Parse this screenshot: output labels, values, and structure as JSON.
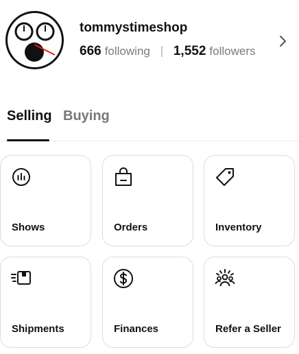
{
  "profile": {
    "username": "tommystimeshop",
    "following_count": "666",
    "following_label": "following",
    "followers_count": "1,552",
    "followers_label": "followers",
    "avatar_icon": "watch-face-avatar",
    "chevron_icon": "chevron-right-icon"
  },
  "tabs": [
    {
      "label": "Selling",
      "active": true
    },
    {
      "label": "Buying",
      "active": false
    }
  ],
  "grid": [
    {
      "label": "Shows",
      "icon": "chart-circle-icon"
    },
    {
      "label": "Orders",
      "icon": "shopping-bag-icon"
    },
    {
      "label": "Inventory",
      "icon": "tag-icon"
    },
    {
      "label": "Shipments",
      "icon": "shipping-box-icon"
    },
    {
      "label": "Finances",
      "icon": "dollar-circle-icon"
    },
    {
      "label": "Refer a Seller",
      "icon": "people-refer-icon"
    }
  ],
  "colors": {
    "text": "#111111",
    "muted": "#777777",
    "border": "#dcdcdc",
    "avatar_accent": "#e02020"
  }
}
